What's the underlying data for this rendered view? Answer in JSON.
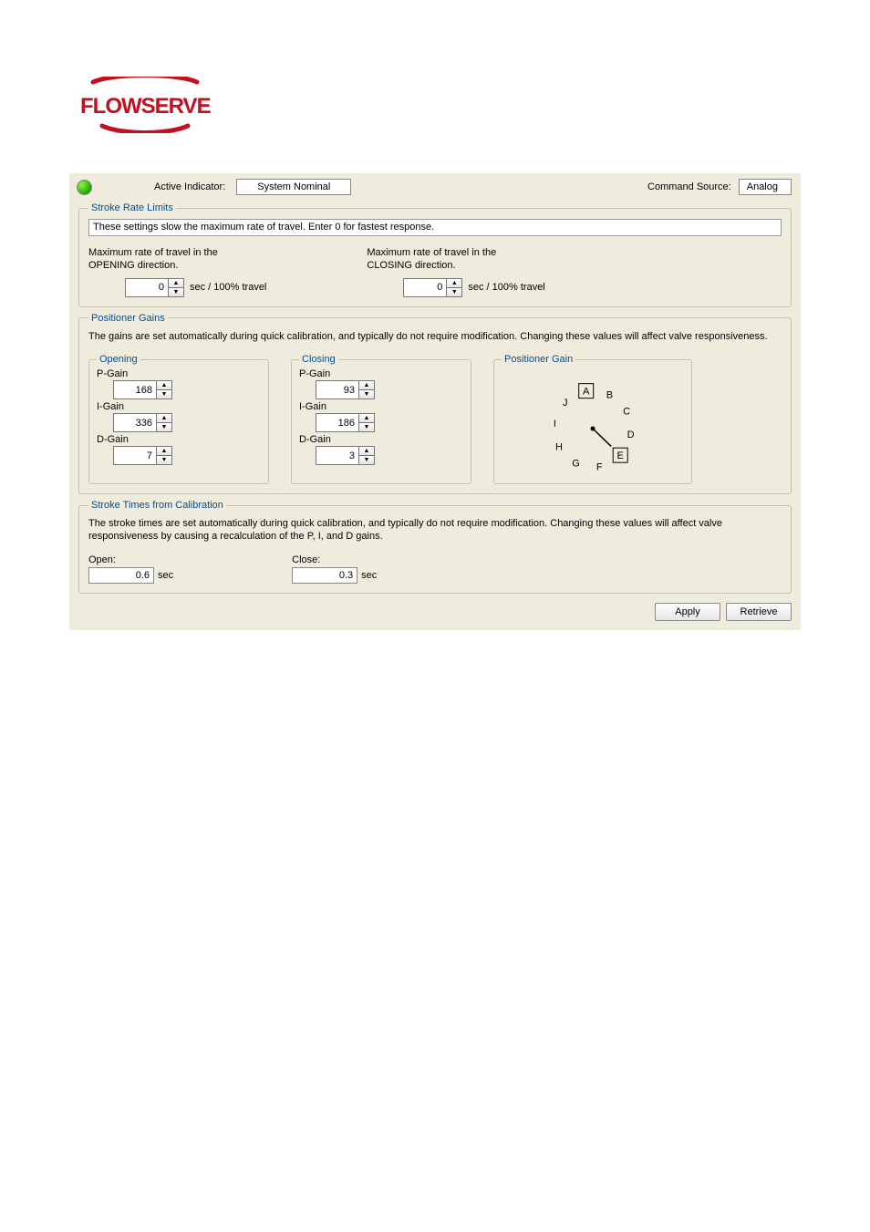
{
  "logo": {
    "name": "FLOWSERVE"
  },
  "body_paragraph": "",
  "status": {
    "active_indicator_label": "Active Indicator:",
    "active_indicator_value": "System Nominal",
    "command_source_label": "Command Source:",
    "command_source_value": "Analog"
  },
  "stroke_rate": {
    "title": "Stroke Rate Limits",
    "desc": "These settings slow the maximum rate of travel.  Enter 0 for fastest response.",
    "opening_label": "Maximum rate of travel in the\nOPENING direction.",
    "closing_label": "Maximum rate of travel in the\nCLOSING direction.",
    "unit_label": "sec / 100% travel",
    "opening_value": "0",
    "closing_value": "0"
  },
  "positioner_gains": {
    "title": "Positioner Gains",
    "desc": "The gains are set automatically during quick calibration, and typically do not require modification.  Changing these values will affect valve responsiveness.",
    "opening": {
      "title": "Opening",
      "p_label": "P-Gain",
      "p_value": "168",
      "i_label": "I-Gain",
      "i_value": "336",
      "d_label": "D-Gain",
      "d_value": "7"
    },
    "closing": {
      "title": "Closing",
      "p_label": "P-Gain",
      "p_value": "93",
      "i_label": "I-Gain",
      "i_value": "186",
      "d_label": "D-Gain",
      "d_value": "3"
    },
    "dial": {
      "title": "Positioner Gain",
      "labels": [
        "A",
        "B",
        "C",
        "D",
        "E",
        "F",
        "G",
        "H",
        "I",
        "J"
      ],
      "selected": "E"
    }
  },
  "stroke_times": {
    "title": "Stroke Times from Calibration",
    "desc": "The stroke times are set automatically during quick calibration, and typically do not require modification. Changing these values will affect valve responsiveness by causing a recalculation of the P, I, and D gains.",
    "open_label": "Open:",
    "open_value": "0.6",
    "close_label": "Close:",
    "close_value": "0.3",
    "unit": "sec"
  },
  "buttons": {
    "apply": "Apply",
    "retrieve": "Retrieve"
  },
  "caption": "",
  "footer_link": {
    "prefix": "",
    "link_text": "",
    "suffix": ""
  },
  "page_footer": {
    "left": "",
    "center": "",
    "right": ""
  }
}
